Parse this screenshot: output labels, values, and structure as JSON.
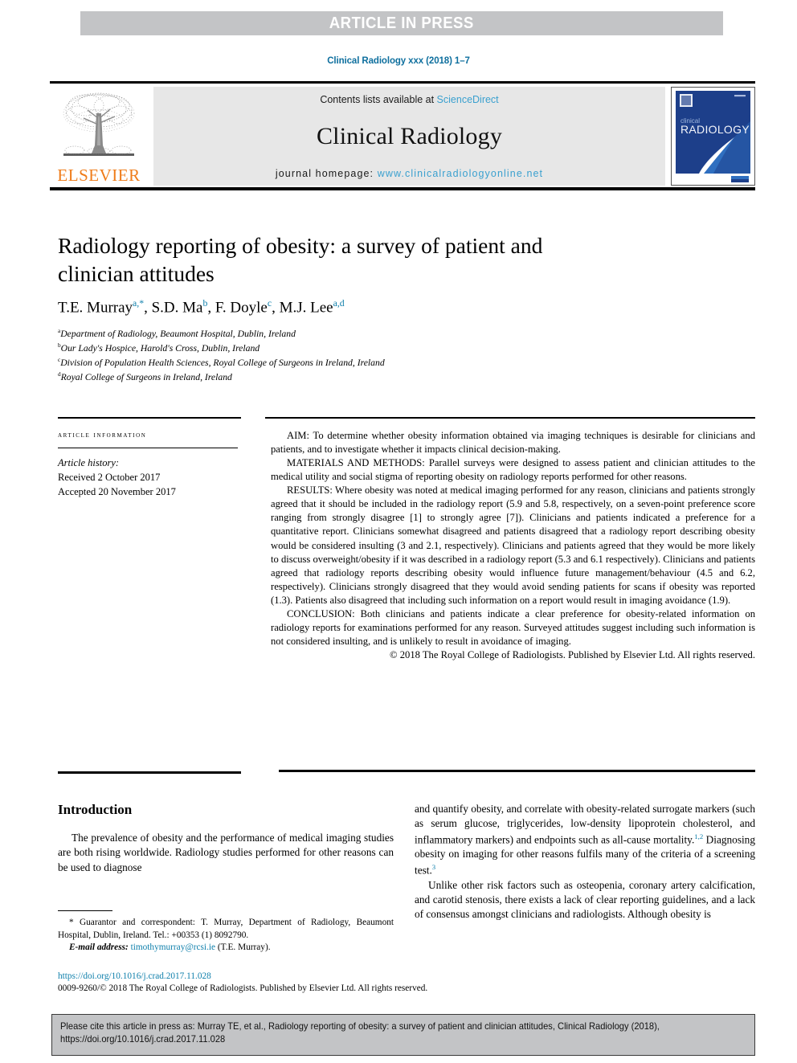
{
  "banner": {
    "label": "ARTICLE IN PRESS"
  },
  "running_head": {
    "text": "Clinical Radiology xxx (2018) 1–7",
    "color": "#0e6f9e"
  },
  "masthead": {
    "publisher_logo_text": "ELSEVIER",
    "publisher_logo_color": "#ef7c1a",
    "contents_prefix": "Contents lists available at ",
    "contents_link": "ScienceDirect",
    "journal_name": "Clinical Radiology",
    "homepage_prefix": "journal homepage: ",
    "homepage_url": "www.clinicalradiologyonline.net",
    "link_color": "#3aa0cf",
    "cover": {
      "title_small": "clinical",
      "title_large": "RADIOLOGY",
      "background": "#1d3f8a"
    }
  },
  "article": {
    "title": "Radiology reporting of obesity: a survey of patient and clinician attitudes",
    "authors_html": "T.E. Murray<sup>a,&#42;</sup>, S.D. Ma<sup>b</sup>, F. Doyle<sup>c</sup>, M.J. Lee<sup>a,d</sup>",
    "affiliations": [
      {
        "marker": "a",
        "text": "Department of Radiology, Beaumont Hospital, Dublin, Ireland"
      },
      {
        "marker": "b",
        "text": "Our Lady's Hospice, Harold's Cross, Dublin, Ireland"
      },
      {
        "marker": "c",
        "text": "Division of Population Health Sciences, Royal College of Surgeons in Ireland, Ireland"
      },
      {
        "marker": "d",
        "text": "Royal College of Surgeons in Ireland, Ireland"
      }
    ]
  },
  "article_information": {
    "heading": "ARTICLE INFORMATION",
    "history_label": "Article history:",
    "received": "Received 2 October 2017",
    "accepted": "Accepted 20 November 2017"
  },
  "abstract": {
    "aim": "AIM: To determine whether obesity information obtained via imaging techniques is desirable for clinicians and patients, and to investigate whether it impacts clinical decision-making.",
    "materials_and_methods": "MATERIALS AND METHODS: Parallel surveys were designed to assess patient and clinician attitudes to the medical utility and social stigma of reporting obesity on radiology reports performed for other reasons.",
    "results": "RESULTS: Where obesity was noted at medical imaging performed for any reason, clinicians and patients strongly agreed that it should be included in the radiology report (5.9 and 5.8, respectively, on a seven-point preference score ranging from strongly disagree [1] to strongly agree [7]). Clinicians and patients indicated a preference for a quantitative report. Clinicians somewhat disagreed and patients disagreed that a radiology report describing obesity would be considered insulting (3 and 2.1, respectively). Clinicians and patients agreed that they would be more likely to discuss overweight/obesity if it was described in a radiology report (5.3 and 6.1 respectively). Clinicians and patients agreed that radiology reports describing obesity would influence future management/behaviour (4.5 and 6.2, respectively). Clinicians strongly disagreed that they would avoid sending patients for scans if obesity was reported (1.3). Patients also disagreed that including such information on a report would result in imaging avoidance (1.9).",
    "conclusion": "CONCLUSION: Both clinicians and patients indicate a clear preference for obesity-related information on radiology reports for examinations performed for any reason. Surveyed attitudes suggest including such information is not considered insulting, and is unlikely to result in avoidance of imaging.",
    "copyright": "© 2018 The Royal College of Radiologists. Published by Elsevier Ltd. All rights reserved."
  },
  "body": {
    "section_heading": "Introduction",
    "left_paragraph_html": "The prevalence of obesity and the performance of medical imaging studies are both rising worldwide. Radiology studies performed for other reasons can be used to diagnose",
    "right_paragraph_1_html": "and quantify obesity, and correlate with obesity-related surrogate markers (such as serum glucose, triglycerides, low-density lipoprotein cholesterol, and inflammatory markers) and endpoints such as all-cause mortality.<sup class=\"ref\">1,2</sup> Diagnosing obesity on imaging for other reasons fulfils many of the criteria of a screening test.<sup class=\"ref\">3</sup>",
    "right_paragraph_2_html": "Unlike other risk factors such as osteopenia, coronary artery calcification, and carotid stenosis, there exists a lack of clear reporting guidelines, and a lack of consensus amongst clinicians and radiologists. Although obesity is"
  },
  "footnote": {
    "correspondence_html": "&#42; Guarantor and correspondent: T. Murray, Department of Radiology, Beaumont Hospital, Dublin, Ireland. Tel.: +00353 (1) 8092790.",
    "email_label": "E-mail address:",
    "email_address": "timothymurray@rcsi.ie",
    "email_suffix": "(T.E. Murray)."
  },
  "doi_block": {
    "doi_url": "https://doi.org/10.1016/j.crad.2017.11.028",
    "issn_line": "0009-9260/© 2018 The Royal College of Radiologists. Published by Elsevier Ltd. All rights reserved."
  },
  "cite_box": {
    "text": "Please cite this article in press as: Murray TE, et al., Radiology reporting of obesity: a survey of patient and clinician attitudes, Clinical Radiology (2018), https://doi.org/10.1016/j.crad.2017.11.028",
    "background": "#c3c4c6"
  }
}
